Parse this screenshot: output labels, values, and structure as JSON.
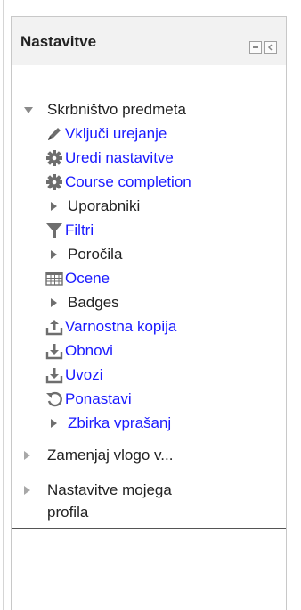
{
  "block": {
    "title": "Nastavitve",
    "hide_icon": "minus-box-icon",
    "dock_icon": "dock-left-icon"
  },
  "tree": {
    "course_admin": {
      "label": "Skrbništvo predmeta",
      "items": [
        {
          "label": "Vključi urejanje",
          "icon": "pencil-icon"
        },
        {
          "label": "Uredi nastavitve",
          "icon": "gear-icon"
        },
        {
          "label": "Course completion",
          "icon": "gear-icon"
        },
        {
          "label": "Uporabniki",
          "icon": "collapsed-arrow-icon"
        },
        {
          "label": "Filtri",
          "icon": "filter-icon"
        },
        {
          "label": "Poročila",
          "icon": "collapsed-arrow-icon"
        },
        {
          "label": "Ocene",
          "icon": "grades-table-icon"
        },
        {
          "label": "Badges",
          "icon": "collapsed-arrow-icon"
        },
        {
          "label": "Varnostna kopija",
          "icon": "backup-icon"
        },
        {
          "label": "Obnovi",
          "icon": "restore-icon"
        },
        {
          "label": "Uvozi",
          "icon": "import-icon"
        },
        {
          "label": "Ponastavi",
          "icon": "reset-icon"
        },
        {
          "label": "Zbirka vprašanj",
          "icon": "collapsed-arrow-icon"
        }
      ]
    },
    "switch_role": {
      "label": "Zamenjaj vlogo v..."
    },
    "profile_settings": {
      "label_line1": "Nastavitve mojega",
      "label_line2": "profila"
    }
  },
  "colors": {
    "link": "#1a1aff",
    "text": "#222222",
    "header_bg": "#f2f2f2",
    "icon": "#6e6e6e"
  }
}
